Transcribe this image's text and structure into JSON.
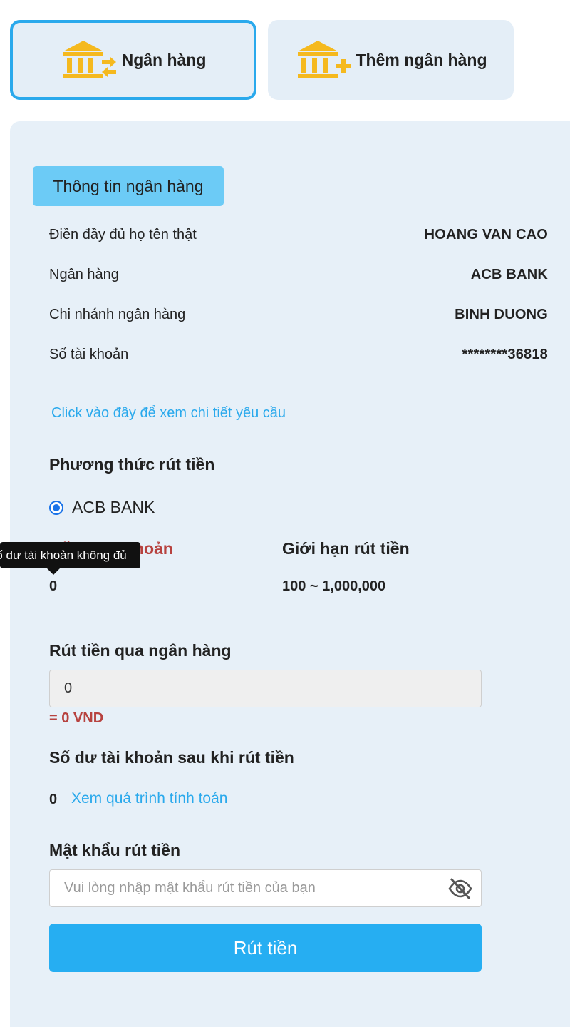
{
  "tabs": [
    {
      "label": "Ngân hàng",
      "icon": "bank-transfer-icon"
    },
    {
      "label": "Thêm ngân hàng",
      "icon": "bank-add-icon"
    }
  ],
  "bank_info": {
    "title": "Thông tin ngân hàng",
    "rows": [
      {
        "label": "Điền đầy đủ họ tên thật",
        "value": "HOANG VAN CAO"
      },
      {
        "label": "Ngân hàng",
        "value": "ACB BANK"
      },
      {
        "label": "Chi nhánh ngân hàng",
        "value": "BINH DUONG"
      },
      {
        "label": "Số tài khoản",
        "value": "********36818"
      }
    ],
    "detail_link": "Click vào đây để xem chi tiết yêu cầu"
  },
  "method": {
    "title": "Phương thức rút tiền",
    "option": "ACB BANK",
    "selected": true
  },
  "balance": {
    "label": "Số dư tài khoản",
    "value": "0",
    "tooltip": "Số dư tài khoản không đủ"
  },
  "limit": {
    "label": "Giới hạn rút tiền",
    "value": "100 ~ 1,000,000"
  },
  "withdraw": {
    "title": "Rút tiền qua ngân hàng",
    "amount": "0",
    "converted": "= 0 VND"
  },
  "after": {
    "title": "Số dư tài khoản sau khi rút tiền",
    "value": "0",
    "link": "Xem quá trình tính toán"
  },
  "password": {
    "title": "Mật khẩu rút tiền",
    "placeholder": "Vui lòng nhập mật khẩu rút tiền của bạn",
    "toggle_icon": "eye-slash-icon"
  },
  "submit_label": "Rút tiền",
  "colors": {
    "accent": "#26aef2",
    "tab_border": "#2aa9ec",
    "badge": "#6ccbf6",
    "panel": "#e7f0f8",
    "warning_text": "#b7423f",
    "icon_gold": "#f5b91e"
  }
}
